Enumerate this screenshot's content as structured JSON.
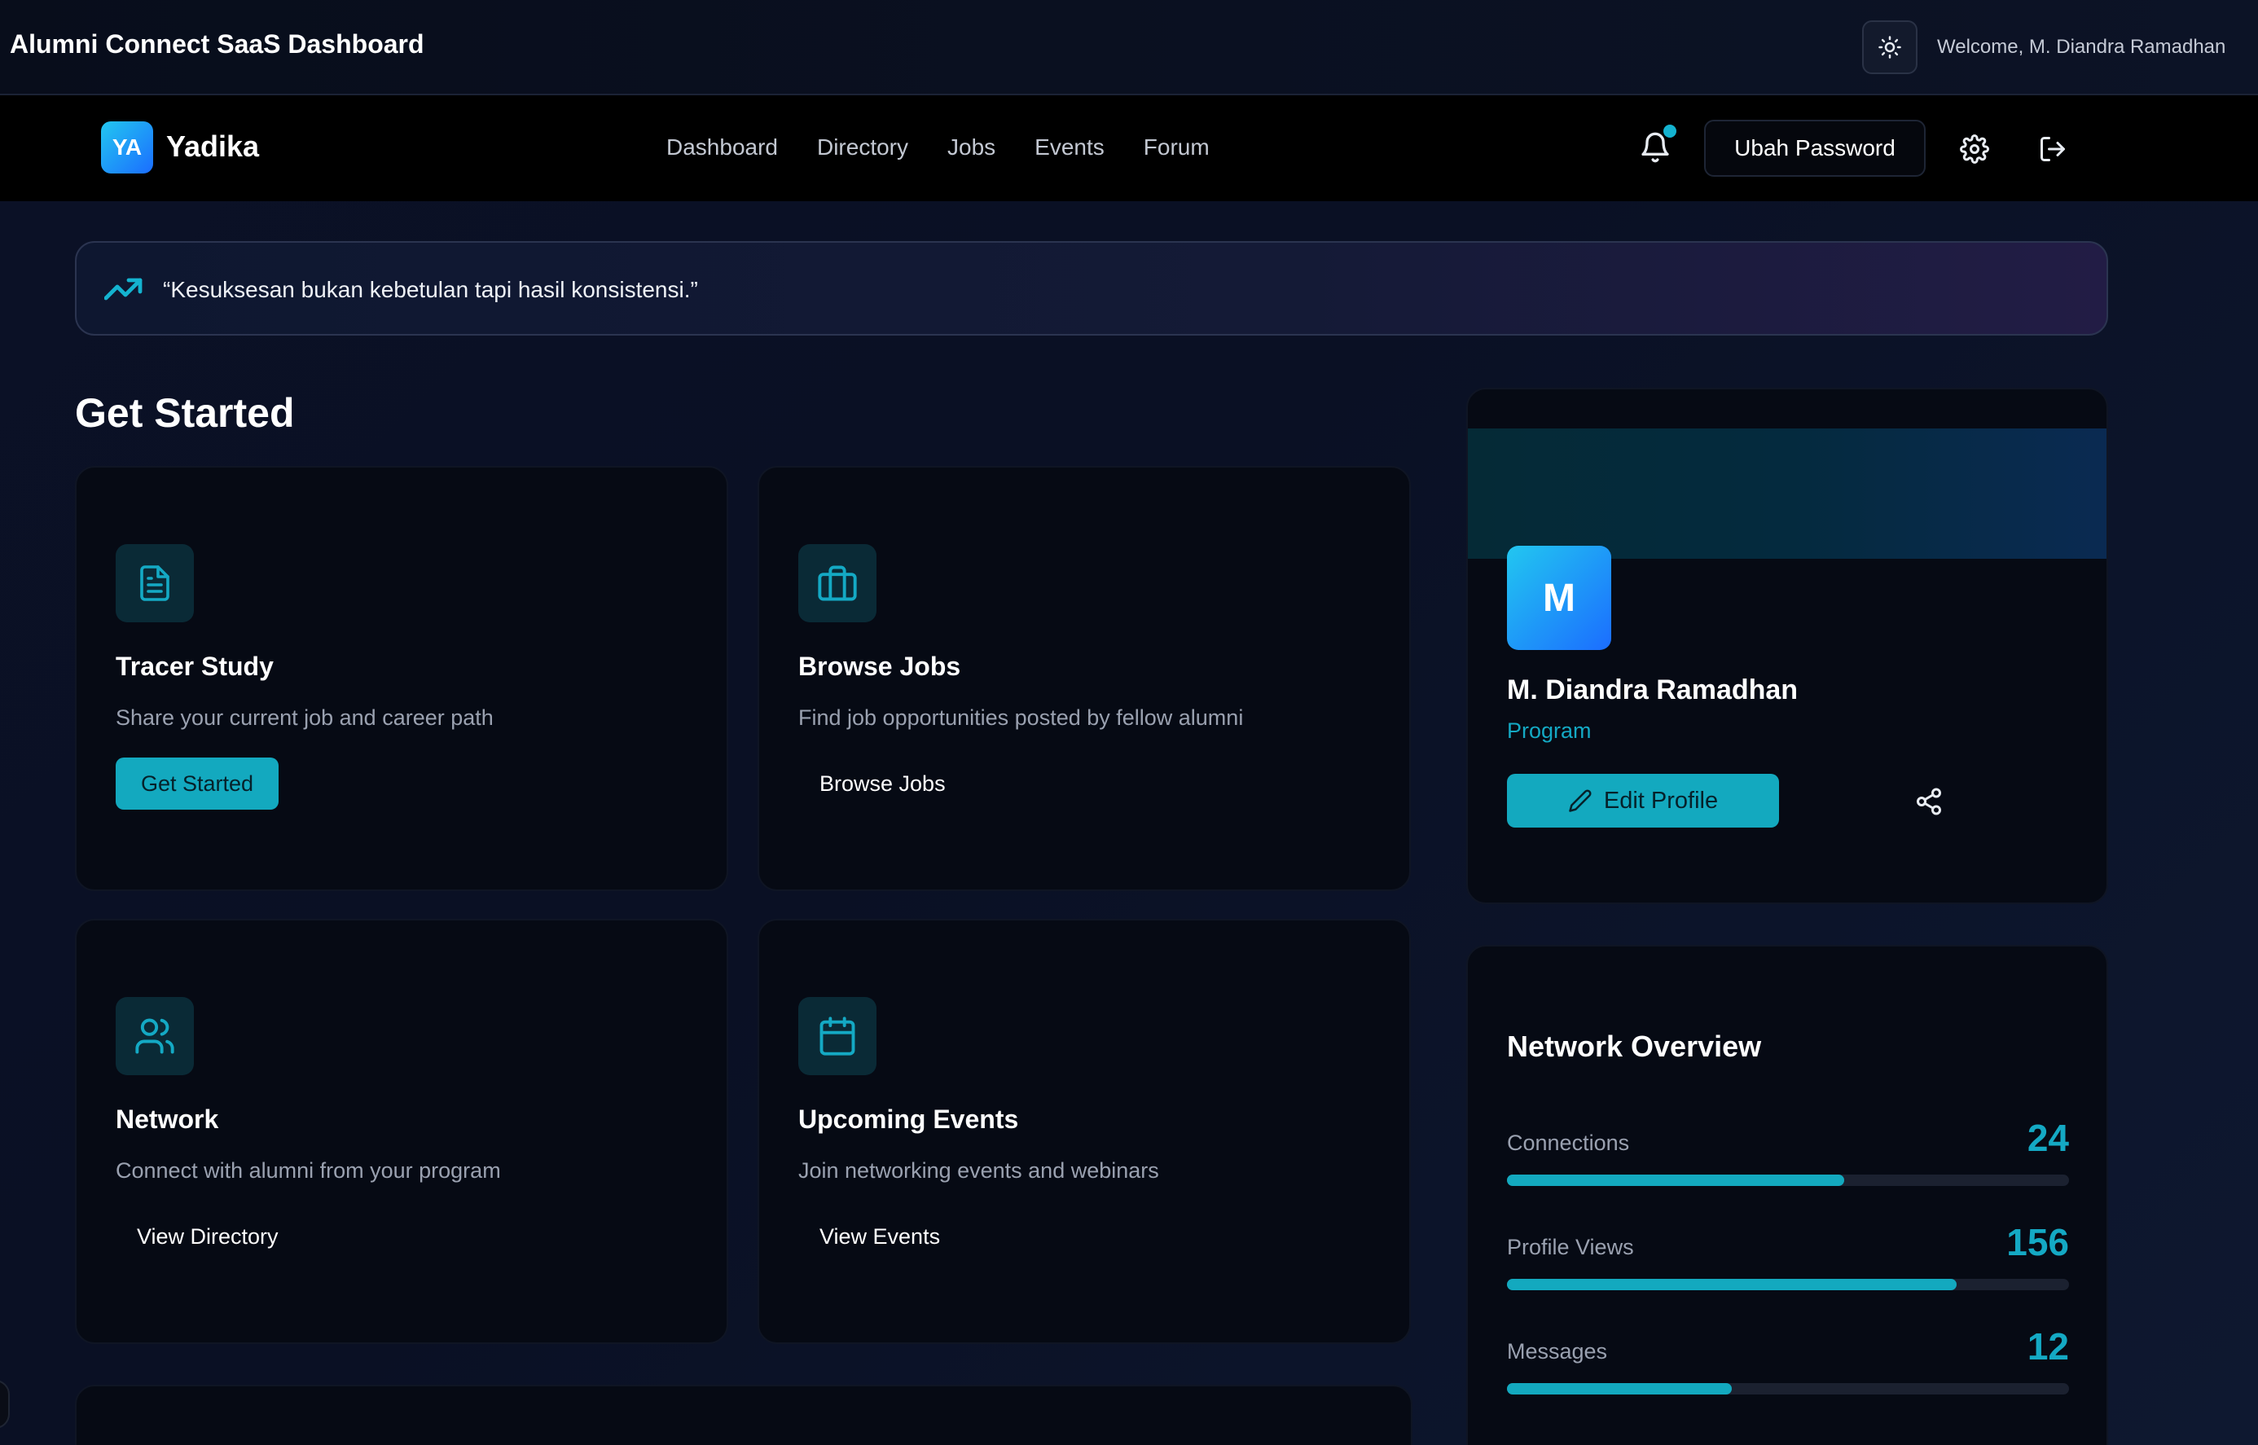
{
  "appbar": {
    "title": "Alumni Connect SaaS Dashboard",
    "welcome": "Welcome, M. Diandra Ramadhan",
    "theme_icon": "sun-icon"
  },
  "navbar": {
    "logo_initials": "YA",
    "brand": "Yadika",
    "links": [
      "Dashboard",
      "Directory",
      "Jobs",
      "Events",
      "Forum"
    ],
    "change_password": "Ubah Password",
    "icons": [
      "bell-icon",
      "gear-icon",
      "logout-icon"
    ]
  },
  "quote": {
    "text": "“Kesuksesan bukan kebetulan tapi hasil konsistensi.”",
    "icon": "trending-up-icon"
  },
  "get_started": {
    "title": "Get Started",
    "cards": [
      {
        "icon": "document-icon",
        "title": "Tracer Study",
        "description": "Share your current job and career path",
        "button": "Get Started",
        "primary": true
      },
      {
        "icon": "briefcase-icon",
        "title": "Browse Jobs",
        "description": "Find job opportunities posted by fellow alumni",
        "button": "Browse Jobs",
        "primary": false
      },
      {
        "icon": "users-icon",
        "title": "Network",
        "description": "Connect with alumni from your program",
        "button": "View Directory",
        "primary": false
      },
      {
        "icon": "calendar-icon",
        "title": "Upcoming Events",
        "description": "Join networking events and webinars",
        "button": "View Events",
        "primary": false
      }
    ]
  },
  "profile": {
    "initial": "M",
    "name": "M. Diandra Ramadhan",
    "program": "Program",
    "edit_button": "Edit Profile"
  },
  "network_overview": {
    "title": "Network Overview",
    "stats": [
      {
        "label": "Connections",
        "value": "24",
        "fill": 0.6
      },
      {
        "label": "Profile Views",
        "value": "156",
        "fill": 0.8
      },
      {
        "label": "Messages",
        "value": "12",
        "fill": 0.4
      }
    ]
  },
  "colors": {
    "accent": "#13a9bf",
    "background": "#0a1024",
    "card": "#060a14"
  }
}
